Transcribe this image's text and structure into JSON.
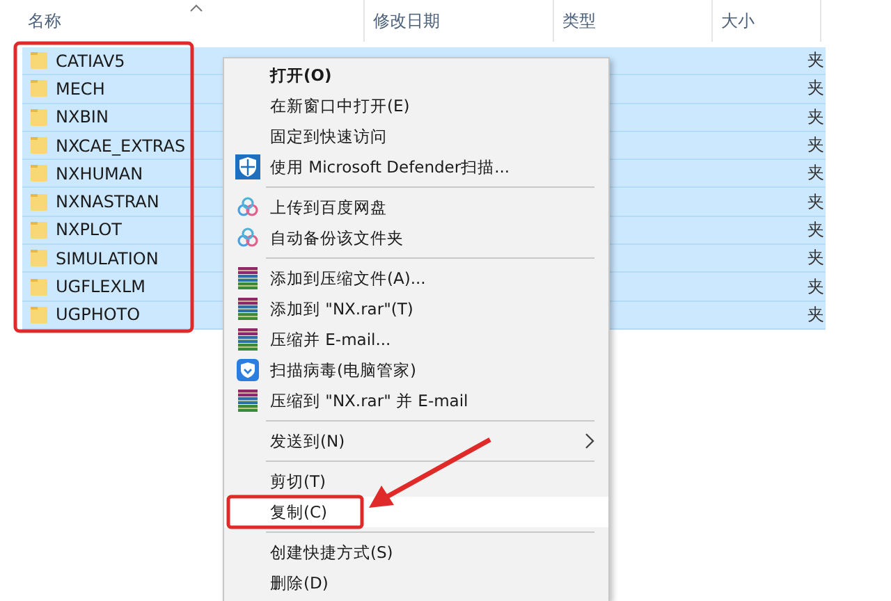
{
  "columns": [
    {
      "label": "名称",
      "sorted": true
    },
    {
      "label": "修改日期",
      "sorted": false
    },
    {
      "label": "类型",
      "sorted": false
    },
    {
      "label": "大小",
      "sorted": false
    }
  ],
  "rows": [
    {
      "name": "CATIAV5",
      "type": "夹",
      "selected": true
    },
    {
      "name": "MECH",
      "type": "夹",
      "selected": true
    },
    {
      "name": "NXBIN",
      "type": "夹",
      "selected": true
    },
    {
      "name": "NXCAE_EXTRAS",
      "type": "夹",
      "selected": true
    },
    {
      "name": "NXHUMAN",
      "type": "夹",
      "selected": true
    },
    {
      "name": "NXNASTRAN",
      "type": "夹",
      "selected": true
    },
    {
      "name": "NXPLOT",
      "type": "夹",
      "selected": true
    },
    {
      "name": "SIMULATION",
      "type": "夹",
      "selected": true
    },
    {
      "name": "UGFLEXLM",
      "type": "夹",
      "selected": true
    },
    {
      "name": "UGPHOTO",
      "type": "夹",
      "selected": true
    }
  ],
  "context_menu": [
    {
      "kind": "plain",
      "label": "打开(O)",
      "bold": true,
      "selected": false
    },
    {
      "kind": "plain",
      "label": "在新窗口中打开(E)",
      "bold": false,
      "selected": false
    },
    {
      "kind": "plain",
      "label": "固定到快速访问",
      "bold": false,
      "selected": false
    },
    {
      "kind": "defender",
      "label": "使用 Microsoft Defender扫描...",
      "bold": false,
      "selected": false
    },
    {
      "kind": "separator"
    },
    {
      "kind": "cloud",
      "label": "上传到百度网盘",
      "bold": false,
      "selected": false
    },
    {
      "kind": "cloud",
      "label": "自动备份该文件夹",
      "bold": false,
      "selected": false
    },
    {
      "kind": "separator"
    },
    {
      "kind": "archive",
      "label": "添加到压缩文件(A)...",
      "bold": false,
      "selected": false
    },
    {
      "kind": "archive",
      "label": "添加到 \"NX.rar\"(T)",
      "bold": false,
      "selected": false
    },
    {
      "kind": "archive",
      "label": "压缩并 E-mail...",
      "bold": false,
      "selected": false
    },
    {
      "kind": "guard",
      "label": "扫描病毒(电脑管家)",
      "bold": false,
      "selected": false
    },
    {
      "kind": "archive",
      "label": "压缩到 \"NX.rar\" 并 E-mail",
      "bold": false,
      "selected": false
    },
    {
      "kind": "separator"
    },
    {
      "kind": "submenu",
      "label": "发送到(N)",
      "bold": false,
      "selected": false
    },
    {
      "kind": "separator"
    },
    {
      "kind": "plain",
      "label": "剪切(T)",
      "bold": false,
      "selected": false
    },
    {
      "kind": "plain",
      "label": "复制(C)",
      "bold": false,
      "selected": true
    },
    {
      "kind": "separator"
    },
    {
      "kind": "plain",
      "label": "创建快捷方式(S)",
      "bold": false,
      "selected": false
    },
    {
      "kind": "plain",
      "label": "删除(D)",
      "bold": false,
      "selected": false
    }
  ]
}
